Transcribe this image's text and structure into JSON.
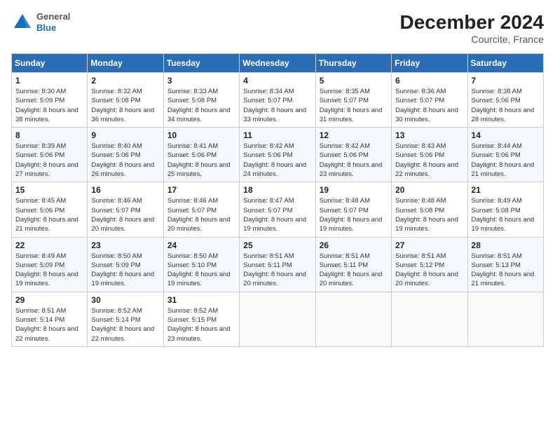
{
  "header": {
    "logo_general": "General",
    "logo_blue": "Blue",
    "title": "December 2024",
    "subtitle": "Courcite, France"
  },
  "columns": [
    "Sunday",
    "Monday",
    "Tuesday",
    "Wednesday",
    "Thursday",
    "Friday",
    "Saturday"
  ],
  "weeks": [
    [
      {
        "day": "1",
        "sunrise": "Sunrise: 8:30 AM",
        "sunset": "Sunset: 5:09 PM",
        "daylight": "Daylight: 8 hours and 38 minutes."
      },
      {
        "day": "2",
        "sunrise": "Sunrise: 8:32 AM",
        "sunset": "Sunset: 5:08 PM",
        "daylight": "Daylight: 8 hours and 36 minutes."
      },
      {
        "day": "3",
        "sunrise": "Sunrise: 8:33 AM",
        "sunset": "Sunset: 5:08 PM",
        "daylight": "Daylight: 8 hours and 34 minutes."
      },
      {
        "day": "4",
        "sunrise": "Sunrise: 8:34 AM",
        "sunset": "Sunset: 5:07 PM",
        "daylight": "Daylight: 8 hours and 33 minutes."
      },
      {
        "day": "5",
        "sunrise": "Sunrise: 8:35 AM",
        "sunset": "Sunset: 5:07 PM",
        "daylight": "Daylight: 8 hours and 31 minutes."
      },
      {
        "day": "6",
        "sunrise": "Sunrise: 8:36 AM",
        "sunset": "Sunset: 5:07 PM",
        "daylight": "Daylight: 8 hours and 30 minutes."
      },
      {
        "day": "7",
        "sunrise": "Sunrise: 8:38 AM",
        "sunset": "Sunset: 5:06 PM",
        "daylight": "Daylight: 8 hours and 28 minutes."
      }
    ],
    [
      {
        "day": "8",
        "sunrise": "Sunrise: 8:39 AM",
        "sunset": "Sunset: 5:06 PM",
        "daylight": "Daylight: 8 hours and 27 minutes."
      },
      {
        "day": "9",
        "sunrise": "Sunrise: 8:40 AM",
        "sunset": "Sunset: 5:06 PM",
        "daylight": "Daylight: 8 hours and 26 minutes."
      },
      {
        "day": "10",
        "sunrise": "Sunrise: 8:41 AM",
        "sunset": "Sunset: 5:06 PM",
        "daylight": "Daylight: 8 hours and 25 minutes."
      },
      {
        "day": "11",
        "sunrise": "Sunrise: 8:42 AM",
        "sunset": "Sunset: 5:06 PM",
        "daylight": "Daylight: 8 hours and 24 minutes."
      },
      {
        "day": "12",
        "sunrise": "Sunrise: 8:42 AM",
        "sunset": "Sunset: 5:06 PM",
        "daylight": "Daylight: 8 hours and 23 minutes."
      },
      {
        "day": "13",
        "sunrise": "Sunrise: 8:43 AM",
        "sunset": "Sunset: 5:06 PM",
        "daylight": "Daylight: 8 hours and 22 minutes."
      },
      {
        "day": "14",
        "sunrise": "Sunrise: 8:44 AM",
        "sunset": "Sunset: 5:06 PM",
        "daylight": "Daylight: 8 hours and 21 minutes."
      }
    ],
    [
      {
        "day": "15",
        "sunrise": "Sunrise: 8:45 AM",
        "sunset": "Sunset: 5:06 PM",
        "daylight": "Daylight: 8 hours and 21 minutes."
      },
      {
        "day": "16",
        "sunrise": "Sunrise: 8:46 AM",
        "sunset": "Sunset: 5:07 PM",
        "daylight": "Daylight: 8 hours and 20 minutes."
      },
      {
        "day": "17",
        "sunrise": "Sunrise: 8:46 AM",
        "sunset": "Sunset: 5:07 PM",
        "daylight": "Daylight: 8 hours and 20 minutes."
      },
      {
        "day": "18",
        "sunrise": "Sunrise: 8:47 AM",
        "sunset": "Sunset: 5:07 PM",
        "daylight": "Daylight: 8 hours and 19 minutes."
      },
      {
        "day": "19",
        "sunrise": "Sunrise: 8:48 AM",
        "sunset": "Sunset: 5:07 PM",
        "daylight": "Daylight: 8 hours and 19 minutes."
      },
      {
        "day": "20",
        "sunrise": "Sunrise: 8:48 AM",
        "sunset": "Sunset: 5:08 PM",
        "daylight": "Daylight: 8 hours and 19 minutes."
      },
      {
        "day": "21",
        "sunrise": "Sunrise: 8:49 AM",
        "sunset": "Sunset: 5:08 PM",
        "daylight": "Daylight: 8 hours and 19 minutes."
      }
    ],
    [
      {
        "day": "22",
        "sunrise": "Sunrise: 8:49 AM",
        "sunset": "Sunset: 5:09 PM",
        "daylight": "Daylight: 8 hours and 19 minutes."
      },
      {
        "day": "23",
        "sunrise": "Sunrise: 8:50 AM",
        "sunset": "Sunset: 5:09 PM",
        "daylight": "Daylight: 8 hours and 19 minutes."
      },
      {
        "day": "24",
        "sunrise": "Sunrise: 8:50 AM",
        "sunset": "Sunset: 5:10 PM",
        "daylight": "Daylight: 8 hours and 19 minutes."
      },
      {
        "day": "25",
        "sunrise": "Sunrise: 8:51 AM",
        "sunset": "Sunset: 5:11 PM",
        "daylight": "Daylight: 8 hours and 20 minutes."
      },
      {
        "day": "26",
        "sunrise": "Sunrise: 8:51 AM",
        "sunset": "Sunset: 5:11 PM",
        "daylight": "Daylight: 8 hours and 20 minutes."
      },
      {
        "day": "27",
        "sunrise": "Sunrise: 8:51 AM",
        "sunset": "Sunset: 5:12 PM",
        "daylight": "Daylight: 8 hours and 20 minutes."
      },
      {
        "day": "28",
        "sunrise": "Sunrise: 8:51 AM",
        "sunset": "Sunset: 5:13 PM",
        "daylight": "Daylight: 8 hours and 21 minutes."
      }
    ],
    [
      {
        "day": "29",
        "sunrise": "Sunrise: 8:51 AM",
        "sunset": "Sunset: 5:14 PM",
        "daylight": "Daylight: 8 hours and 22 minutes."
      },
      {
        "day": "30",
        "sunrise": "Sunrise: 8:52 AM",
        "sunset": "Sunset: 5:14 PM",
        "daylight": "Daylight: 8 hours and 22 minutes."
      },
      {
        "day": "31",
        "sunrise": "Sunrise: 8:52 AM",
        "sunset": "Sunset: 5:15 PM",
        "daylight": "Daylight: 8 hours and 23 minutes."
      },
      null,
      null,
      null,
      null
    ]
  ]
}
